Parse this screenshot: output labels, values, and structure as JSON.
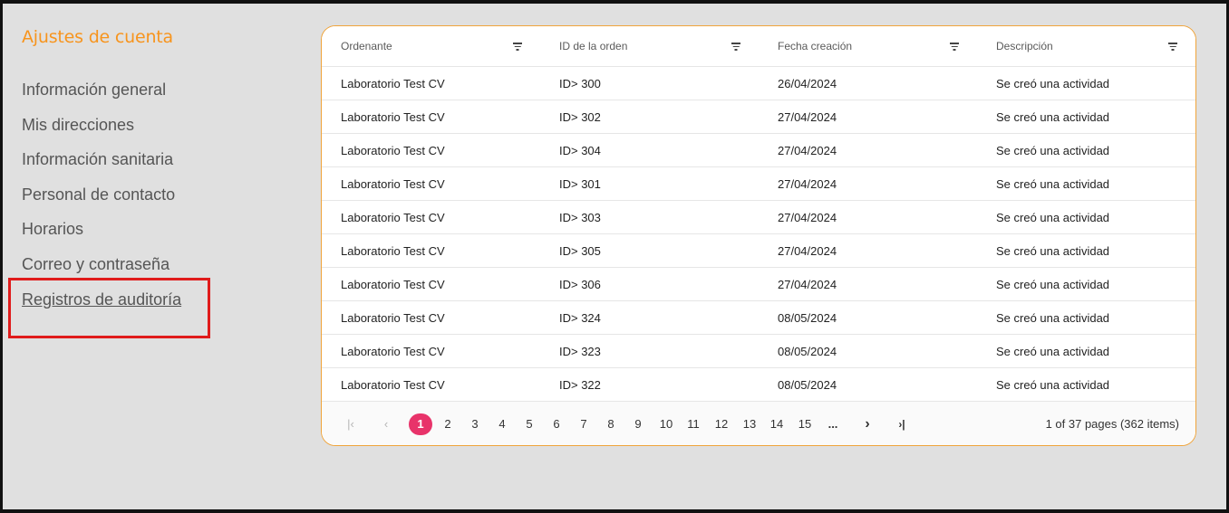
{
  "sidebar": {
    "title": "Ajustes de cuenta",
    "items": [
      {
        "label": "Información general"
      },
      {
        "label": "Mis direcciones"
      },
      {
        "label": "Información sanitaria"
      },
      {
        "label": "Personal de contacto"
      },
      {
        "label": "Horarios"
      },
      {
        "label": "Correo y contraseña"
      },
      {
        "label": "Registros de auditoría",
        "active": true
      }
    ]
  },
  "table": {
    "columns": [
      "Ordenante",
      "ID de la orden",
      "Fecha creación",
      "Descripción"
    ],
    "rows": [
      [
        "Laboratorio Test CV",
        "ID> 300",
        "26/04/2024",
        "Se creó una actividad"
      ],
      [
        "Laboratorio Test CV",
        "ID> 302",
        "27/04/2024",
        "Se creó una actividad"
      ],
      [
        "Laboratorio Test CV",
        "ID> 304",
        "27/04/2024",
        "Se creó una actividad"
      ],
      [
        "Laboratorio Test CV",
        "ID> 301",
        "27/04/2024",
        "Se creó una actividad"
      ],
      [
        "Laboratorio Test CV",
        "ID> 303",
        "27/04/2024",
        "Se creó una actividad"
      ],
      [
        "Laboratorio Test CV",
        "ID> 305",
        "27/04/2024",
        "Se creó una actividad"
      ],
      [
        "Laboratorio Test CV",
        "ID> 306",
        "27/04/2024",
        "Se creó una actividad"
      ],
      [
        "Laboratorio Test CV",
        "ID> 324",
        "08/05/2024",
        "Se creó una actividad"
      ],
      [
        "Laboratorio Test CV",
        "ID> 323",
        "08/05/2024",
        "Se creó una actividad"
      ],
      [
        "Laboratorio Test CV",
        "ID> 322",
        "08/05/2024",
        "Se creó una actividad"
      ]
    ]
  },
  "pager": {
    "first": "|‹",
    "prev": "‹",
    "pages": [
      "1",
      "2",
      "3",
      "4",
      "5",
      "6",
      "7",
      "8",
      "9",
      "10",
      "11",
      "12",
      "13",
      "14",
      "15"
    ],
    "current": "1",
    "more": "...",
    "next": "›",
    "last": "›|",
    "info": "1 of 37 pages (362 items)"
  },
  "colors": {
    "accent": "#f7941d",
    "page_active": "#e8336a",
    "highlight": "#e01b1b"
  }
}
